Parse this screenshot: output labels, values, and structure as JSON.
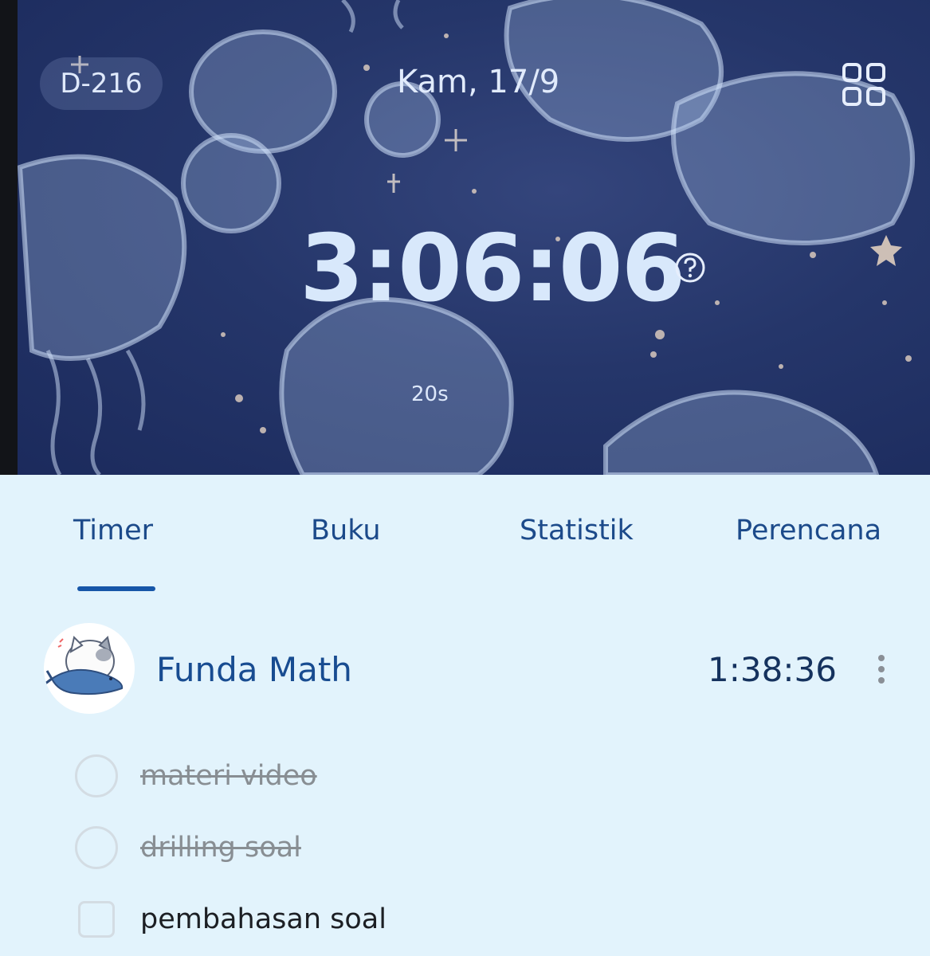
{
  "header": {
    "dday": "D-216",
    "date": "Kam, 17/9"
  },
  "timer": {
    "total": "3:06:06",
    "seconds_label": "20s"
  },
  "tabs": [
    {
      "label": "Timer",
      "active": true
    },
    {
      "label": "Buku",
      "active": false
    },
    {
      "label": "Statistik",
      "active": false
    },
    {
      "label": "Perencana",
      "active": false
    }
  ],
  "subject": {
    "name": "Funda Math",
    "time": "1:38:36"
  },
  "tasks": [
    {
      "label": "materi video",
      "done": true
    },
    {
      "label": "drilling soal",
      "done": true
    },
    {
      "label": "pembahasan soal",
      "done": false
    }
  ],
  "colors": {
    "accent": "#1656a8",
    "background": "#e2f3fc",
    "hero": "#25366a"
  },
  "icons": {
    "layout": "grid-icon",
    "help": "help-circle-icon",
    "more": "more-vertical-icon"
  }
}
